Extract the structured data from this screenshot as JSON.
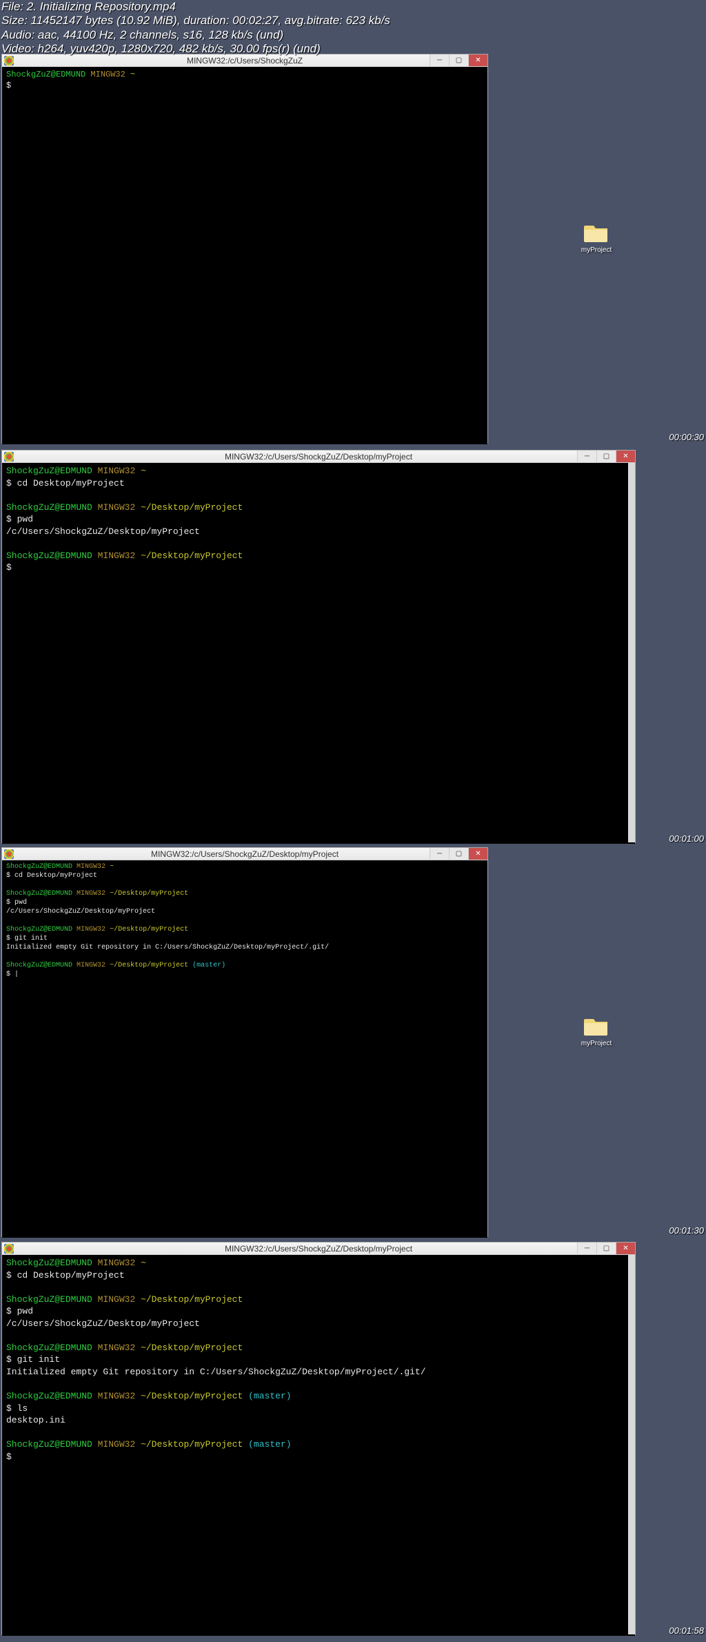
{
  "media_info": {
    "file": "File: 2. Initializing Repository.mp4",
    "size": "Size: 11452147 bytes (10.92 MiB), duration: 00:02:27, avg.bitrate: 623 kb/s",
    "audio": "Audio: aac, 44100 Hz, 2 channels, s16, 128 kb/s (und)",
    "video": "Video: h264, yuv420p, 1280x720, 482 kb/s, 30.00 fps(r) (und)"
  },
  "folder_label": "myProject",
  "frames": {
    "f1": {
      "title": "MINGW32:/c/Users/ShockgZuZ",
      "timestamp": "00:00:30",
      "lines": [
        {
          "user": "ShockgZuZ@EDMUND",
          "host": "MINGW32",
          "path": "~"
        },
        {
          "out": "$"
        }
      ]
    },
    "f2": {
      "title": "MINGW32:/c/Users/ShockgZuZ/Desktop/myProject",
      "timestamp": "00:01:00",
      "lines": [
        {
          "user": "ShockgZuZ@EDMUND",
          "host": "MINGW32",
          "path": "~"
        },
        {
          "out": "$ cd Desktop/myProject"
        },
        {
          "blank": true
        },
        {
          "user": "ShockgZuZ@EDMUND",
          "host": "MINGW32",
          "path": "~/Desktop/myProject"
        },
        {
          "out": "$ pwd"
        },
        {
          "out": "/c/Users/ShockgZuZ/Desktop/myProject"
        },
        {
          "blank": true
        },
        {
          "user": "ShockgZuZ@EDMUND",
          "host": "MINGW32",
          "path": "~/Desktop/myProject"
        },
        {
          "out": "$"
        }
      ]
    },
    "f3": {
      "title": "MINGW32:/c/Users/ShockgZuZ/Desktop/myProject",
      "timestamp": "00:01:30",
      "lines": [
        {
          "user": "ShockgZuZ@EDMUND",
          "host": "MINGW32",
          "path": "~"
        },
        {
          "out": "$ cd Desktop/myProject"
        },
        {
          "blank": true
        },
        {
          "user": "ShockgZuZ@EDMUND",
          "host": "MINGW32",
          "path": "~/Desktop/myProject"
        },
        {
          "out": "$ pwd"
        },
        {
          "out": "/c/Users/ShockgZuZ/Desktop/myProject"
        },
        {
          "blank": true
        },
        {
          "user": "ShockgZuZ@EDMUND",
          "host": "MINGW32",
          "path": "~/Desktop/myProject"
        },
        {
          "out": "$ git init"
        },
        {
          "out": "Initialized empty Git repository in C:/Users/ShockgZuZ/Desktop/myProject/.git/"
        },
        {
          "blank": true
        },
        {
          "user": "ShockgZuZ@EDMUND",
          "host": "MINGW32",
          "path": "~/Desktop/myProject",
          "branch": "(master)"
        },
        {
          "out": "$ |"
        }
      ]
    },
    "f4": {
      "title": "MINGW32:/c/Users/ShockgZuZ/Desktop/myProject",
      "timestamp": "00:01:58",
      "lines": [
        {
          "user": "ShockgZuZ@EDMUND",
          "host": "MINGW32",
          "path": "~"
        },
        {
          "out": "$ cd Desktop/myProject"
        },
        {
          "blank": true
        },
        {
          "user": "ShockgZuZ@EDMUND",
          "host": "MINGW32",
          "path": "~/Desktop/myProject"
        },
        {
          "out": "$ pwd"
        },
        {
          "out": "/c/Users/ShockgZuZ/Desktop/myProject"
        },
        {
          "blank": true
        },
        {
          "user": "ShockgZuZ@EDMUND",
          "host": "MINGW32",
          "path": "~/Desktop/myProject"
        },
        {
          "out": "$ git init"
        },
        {
          "out": "Initialized empty Git repository in C:/Users/ShockgZuZ/Desktop/myProject/.git/"
        },
        {
          "blank": true
        },
        {
          "user": "ShockgZuZ@EDMUND",
          "host": "MINGW32",
          "path": "~/Desktop/myProject",
          "branch": "(master)"
        },
        {
          "out": "$ ls"
        },
        {
          "out": "desktop.ini"
        },
        {
          "blank": true
        },
        {
          "user": "ShockgZuZ@EDMUND",
          "host": "MINGW32",
          "path": "~/Desktop/myProject",
          "branch": "(master)"
        },
        {
          "out": "$"
        }
      ]
    }
  }
}
